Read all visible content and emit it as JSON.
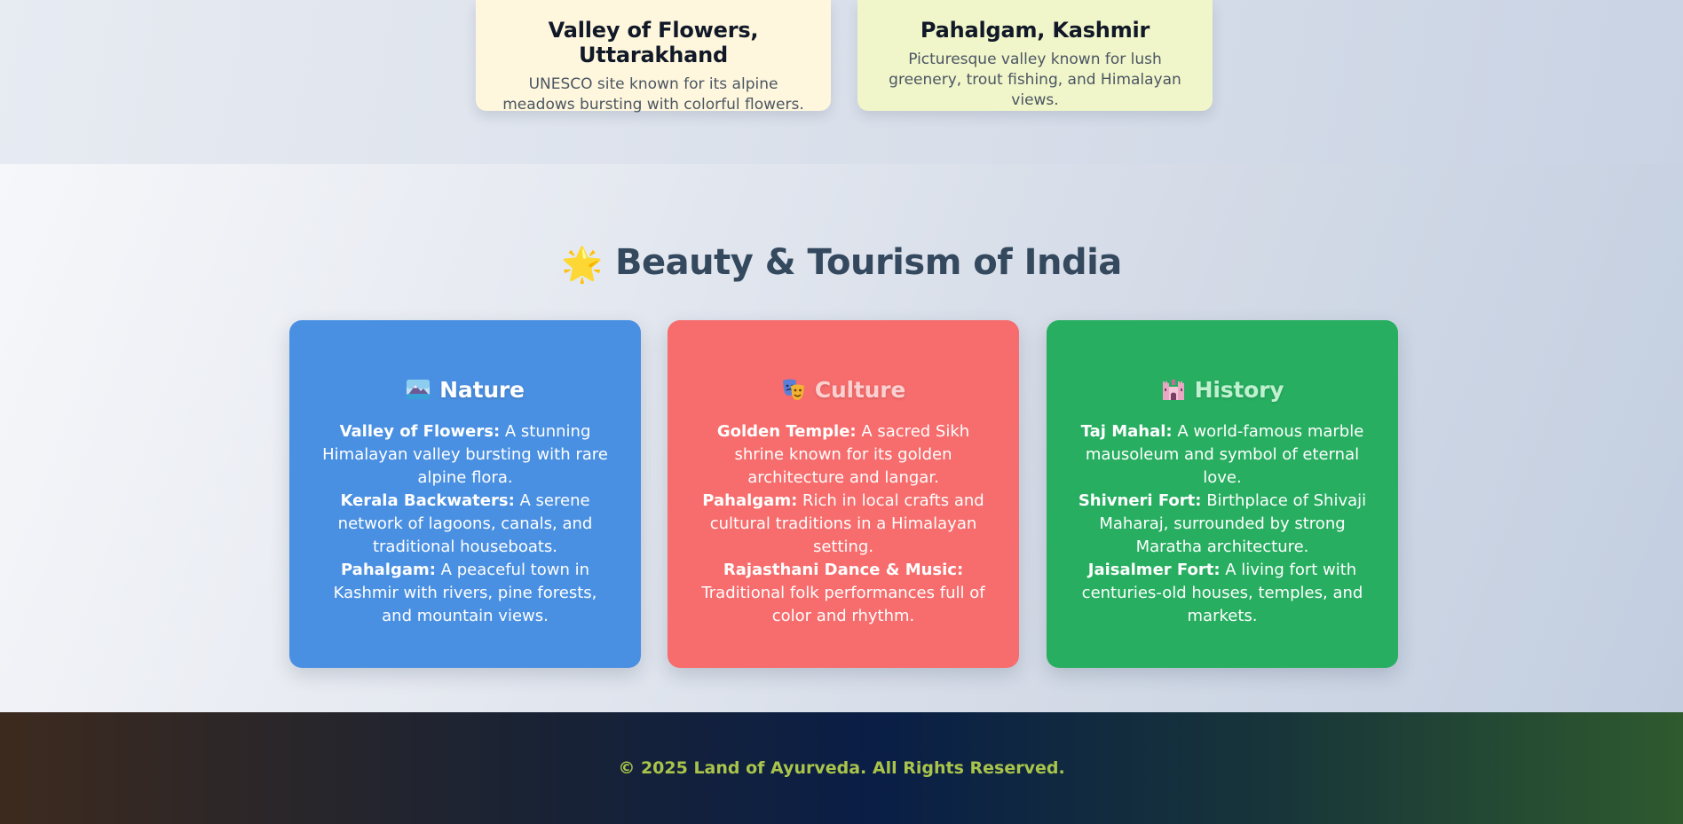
{
  "destinations": [
    {
      "title": "Valley of Flowers, Uttarakhand",
      "description": "UNESCO site known for its alpine meadows bursting with colorful flowers."
    },
    {
      "title": "Pahalgam, Kashmir",
      "description": "Picturesque valley known for lush greenery, trout fishing, and Himalayan views."
    }
  ],
  "tourism": {
    "title_emoji": "🌟",
    "title": "Beauty & Tourism of India",
    "cards": [
      {
        "icon": "mountain-lake-icon",
        "heading": "Nature",
        "items": [
          {
            "name": "Valley of Flowers:",
            "text": " A stunning Himalayan valley bursting with rare alpine flora."
          },
          {
            "name": "Kerala Backwaters:",
            "text": " A serene network of lagoons, canals, and traditional houseboats."
          },
          {
            "name": "Pahalgam:",
            "text": " A peaceful town in Kashmir with rivers, pine forests, and mountain views."
          }
        ]
      },
      {
        "icon": "theater-masks-icon",
        "heading": "Culture",
        "items": [
          {
            "name": "Golden Temple:",
            "text": " A sacred Sikh shrine known for its golden architecture and langar."
          },
          {
            "name": "Pahalgam:",
            "text": " Rich in local crafts and cultural traditions in a Himalayan setting."
          },
          {
            "name": "Rajasthani Dance & Music:",
            "text": " Traditional folk performances full of color and rhythm."
          }
        ]
      },
      {
        "icon": "castle-icon",
        "heading": "History",
        "items": [
          {
            "name": "Taj Mahal:",
            "text": " A world-famous marble mausoleum and symbol of eternal love."
          },
          {
            "name": "Shivneri Fort:",
            "text": " Birthplace of Shivaji Maharaj, surrounded by strong Maratha architecture."
          },
          {
            "name": "Jaisalmer Fort:",
            "text": " A living fort with centuries-old houses, temples, and markets."
          }
        ]
      }
    ]
  },
  "footer": {
    "text": "© 2025 Land of Ayurveda. All Rights Reserved."
  },
  "colors": {
    "nature_card": "#4a90e2",
    "culture_card": "#f76c6c",
    "history_card": "#27ae60",
    "footer_text": "#a9c44a",
    "section_title": "#34495e"
  }
}
